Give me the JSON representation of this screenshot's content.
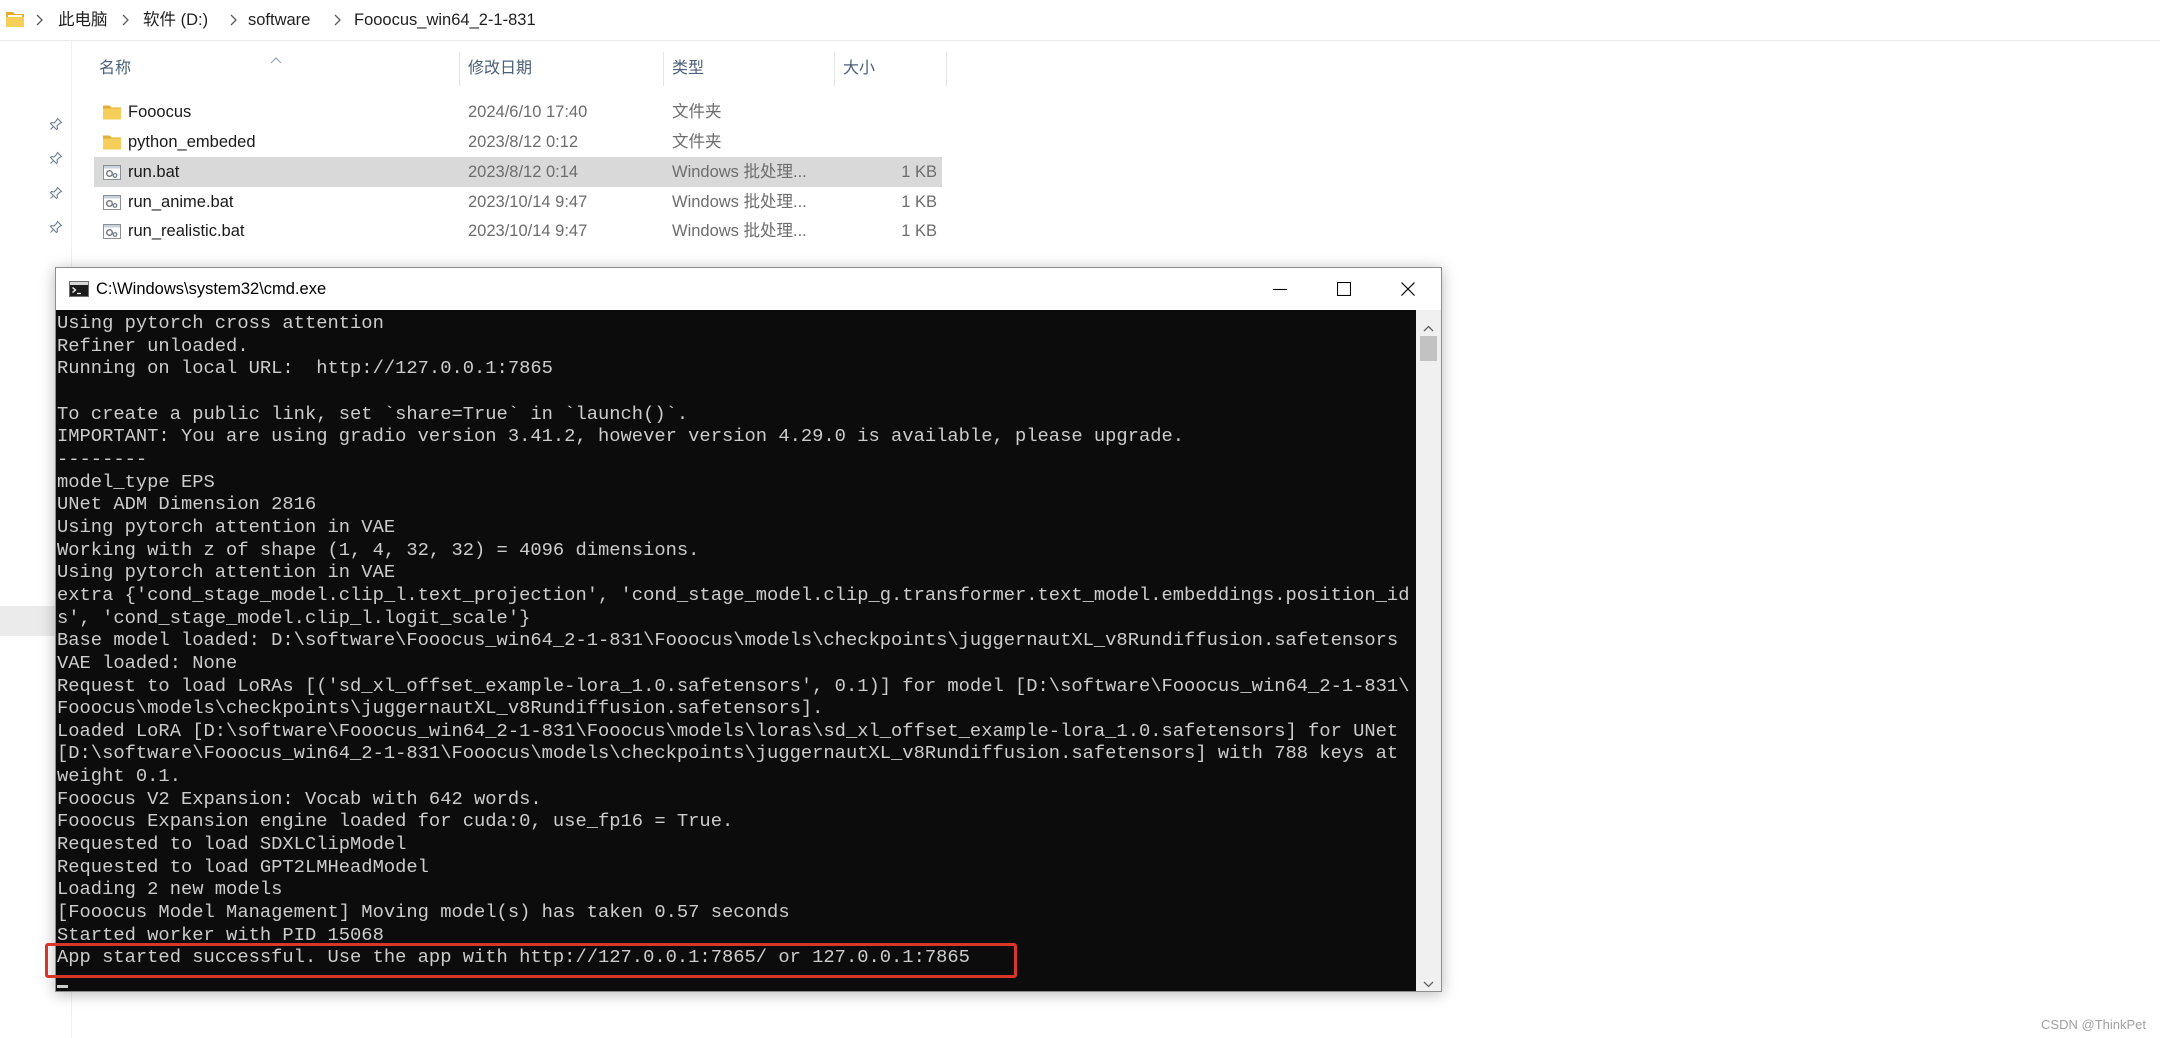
{
  "explorer": {
    "breadcrumb": [
      "此电脑",
      "软件 (D:)",
      "software",
      "Fooocus_win64_2-1-831"
    ],
    "columns": {
      "name": "名称",
      "date": "修改日期",
      "type": "类型",
      "size": "大小"
    },
    "sort_icon": "chevron-up-icon",
    "files": [
      {
        "name": "Fooocus",
        "date": "2024/6/10 17:40",
        "type": "文件夹",
        "icon": "folder-icon",
        "selected": false
      },
      {
        "name": "python_embeded",
        "date": "2023/8/12 0:12",
        "type": "文件夹",
        "icon": "folder-icon",
        "selected": false
      },
      {
        "name": "run.bat",
        "date": "2023/8/12 0:14",
        "type": "Windows 批处理...",
        "size": "1 KB",
        "icon": "batch-file-icon",
        "selected": true
      },
      {
        "name": "run_anime.bat",
        "date": "2023/10/14 9:47",
        "type": "Windows 批处理...",
        "size": "1 KB",
        "icon": "batch-file-icon",
        "selected": false
      },
      {
        "name": "run_realistic.bat",
        "date": "2023/10/14 9:47",
        "type": "Windows 批处理...",
        "size": "1 KB",
        "icon": "batch-file-icon",
        "selected": false
      }
    ]
  },
  "cmd": {
    "title": "C:\\Windows\\system32\\cmd.exe",
    "lines": [
      "Using pytorch cross attention",
      "Refiner unloaded.",
      "Running on local URL:  http://127.0.0.1:7865",
      "",
      "To create a public link, set `share=True` in `launch()`.",
      "IMPORTANT: You are using gradio version 3.41.2, however version 4.29.0 is available, please upgrade.",
      "--------",
      "model_type EPS",
      "UNet ADM Dimension 2816",
      "Using pytorch attention in VAE",
      "Working with z of shape (1, 4, 32, 32) = 4096 dimensions.",
      "Using pytorch attention in VAE",
      "extra {'cond_stage_model.clip_l.text_projection', 'cond_stage_model.clip_g.transformer.text_model.embeddings.position_id",
      "s', 'cond_stage_model.clip_l.logit_scale'}",
      "Base model loaded: D:\\software\\Fooocus_win64_2-1-831\\Fooocus\\models\\checkpoints\\juggernautXL_v8Rundiffusion.safetensors",
      "VAE loaded: None",
      "Request to load LoRAs [('sd_xl_offset_example-lora_1.0.safetensors', 0.1)] for model [D:\\software\\Fooocus_win64_2-1-831\\",
      "Fooocus\\models\\checkpoints\\juggernautXL_v8Rundiffusion.safetensors].",
      "Loaded LoRA [D:\\software\\Fooocus_win64_2-1-831\\Fooocus\\models\\loras\\sd_xl_offset_example-lora_1.0.safetensors] for UNet",
      "[D:\\software\\Fooocus_win64_2-1-831\\Fooocus\\models\\checkpoints\\juggernautXL_v8Rundiffusion.safetensors] with 788 keys at",
      "weight 0.1.",
      "Fooocus V2 Expansion: Vocab with 642 words.",
      "Fooocus Expansion engine loaded for cuda:0, use_fp16 = True.",
      "Requested to load SDXLClipModel",
      "Requested to load GPT2LMHeadModel",
      "Loading 2 new models",
      "[Fooocus Model Management] Moving model(s) has taken 0.57 seconds",
      "Started worker with PID 15068",
      "App started successful. Use the app with http://127.0.0.1:7865/ or 127.0.0.1:7865"
    ]
  },
  "watermark": "CSDN @ThinkPet",
  "colors": {
    "console_bg": "#0c0c0c",
    "console_text": "#cccccc",
    "selection": "#d9d9d9",
    "highlight_box": "#d9362b",
    "folder_yellow": "#f6cf5a",
    "header_text": "#4c607a",
    "secondary_text": "#6d6d6d"
  }
}
